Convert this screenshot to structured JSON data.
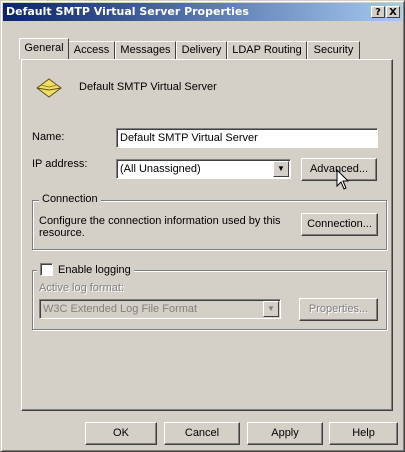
{
  "window": {
    "title": "Default SMTP Virtual Server Properties",
    "help_button": "?",
    "close_button": "X"
  },
  "tabs": [
    {
      "label": "General",
      "active": true
    },
    {
      "label": "Access",
      "active": false
    },
    {
      "label": "Messages",
      "active": false
    },
    {
      "label": "Delivery",
      "active": false
    },
    {
      "label": "LDAP Routing",
      "active": false
    },
    {
      "label": "Security",
      "active": false
    }
  ],
  "general": {
    "server_name_header": "Default SMTP Virtual Server",
    "name_label": "Name:",
    "name_value": "Default SMTP Virtual Server",
    "ip_label": "IP address:",
    "ip_value": "(All Unassigned)",
    "advanced_button": "Advanced...",
    "connection_group": "Connection",
    "connection_desc": "Configure the connection information used by this resource.",
    "connection_button": "Connection...",
    "enable_logging_label": "Enable logging",
    "enable_logging_checked": false,
    "log_format_label": "Active log format:",
    "log_format_value": "W3C Extended Log File Format",
    "properties_button": "Properties..."
  },
  "footer": {
    "ok": "OK",
    "cancel": "Cancel",
    "apply": "Apply",
    "help": "Help"
  },
  "icons": {
    "server": "envelope-icon"
  }
}
